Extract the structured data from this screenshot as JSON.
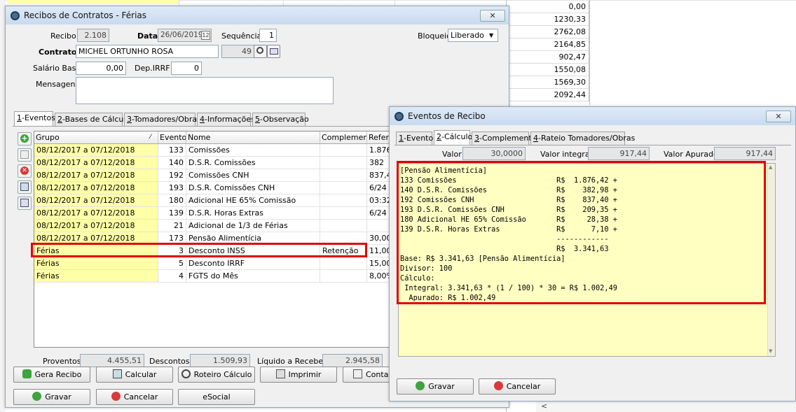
{
  "bg_values": [
    "0,00",
    "1230,33",
    "2762,08",
    "2164,85",
    "902,47",
    "1550,08",
    "1569,30",
    "2092,44"
  ],
  "main": {
    "title": "Recibos de Contratos - Férias",
    "close_label": "✕",
    "recibo_label": "Recibo",
    "recibo_value": "2.108",
    "data_label": "Data",
    "data_value": "26/06/2019",
    "calendar_label": "12",
    "sequencia_label": "Sequência",
    "sequencia_value": "1",
    "bloqueio_label": "Bloqueio",
    "bloqueio_value": "Liberado",
    "contrato_label": "Contrato",
    "contrato_value": "MICHEL ORTUNHO ROSA",
    "contrato_code": "49",
    "salario_label": "Salário Base",
    "salario_value": "0,00",
    "dep_label": "Dep.IRRF",
    "dep_value": "0",
    "mensagens_label": "Mensagens",
    "tabs": [
      {
        "num": "1",
        "label": "-Eventos"
      },
      {
        "num": "2",
        "label": "-Bases de Cálculo"
      },
      {
        "num": "3",
        "label": "-Tomadores/Obras"
      },
      {
        "num": "4",
        "label": "-Informações"
      },
      {
        "num": "5",
        "label": "-Observação"
      }
    ],
    "columns": [
      "Grupo",
      "Evento",
      "Nome",
      "Complemento",
      "Referê"
    ],
    "sort_glyph": "⁄",
    "rows": [
      {
        "grupo": "08/12/2017 a 07/12/2018",
        "evento": "133",
        "nome": "Comissões",
        "complemento": "",
        "referencia": "1.876,"
      },
      {
        "grupo": "08/12/2017 a 07/12/2018",
        "evento": "140",
        "nome": "D.S.R. Comissões",
        "complemento": "",
        "referencia": "382"
      },
      {
        "grupo": "08/12/2017 a 07/12/2018",
        "evento": "192",
        "nome": "Comissões CNH",
        "complemento": "",
        "referencia": "837,40"
      },
      {
        "grupo": "08/12/2017 a 07/12/2018",
        "evento": "193",
        "nome": "D.S.R. Comissões CNH",
        "complemento": "",
        "referencia": "6/24 d"
      },
      {
        "grupo": "08/12/2017 a 07/12/2018",
        "evento": "180",
        "nome": "Adicional HE 65% Comissão",
        "complemento": "",
        "referencia": "03:32"
      },
      {
        "grupo": "08/12/2017 a 07/12/2018",
        "evento": "139",
        "nome": "D.S.R. Horas Extras",
        "complemento": "",
        "referencia": "6/24 d"
      },
      {
        "grupo": "08/12/2017 a 07/12/2018",
        "evento": "21",
        "nome": "Adicional de 1/3 de Férias",
        "complemento": "",
        "referencia": ""
      },
      {
        "grupo": "08/12/2017 a 07/12/2018",
        "evento": "173",
        "nome": "Pensão Alimentícia",
        "complemento": "",
        "referencia": "30,00"
      },
      {
        "grupo": "Férias",
        "evento": "3",
        "nome": "Desconto INSS",
        "complemento": "Retenção",
        "referencia": "11,00"
      },
      {
        "grupo": "Férias",
        "evento": "5",
        "nome": "Desconto IRRF",
        "complemento": "",
        "referencia": "15,00"
      },
      {
        "grupo": "Férias",
        "evento": "4",
        "nome": "FGTS do Mês",
        "complemento": "",
        "referencia": "8,00%"
      }
    ],
    "totals": {
      "proventos_label": "Proventos",
      "proventos_value": "4.455,51",
      "descontos_label": "Descontos",
      "descontos_value": "1.509,93",
      "liquido_label": "Líquido a Receber",
      "liquido_value": "2.945,58"
    },
    "buttons": {
      "gera_recibo": "Gera Recibo",
      "calcular": "Calcular",
      "roteiro": "Roteiro Cálculo",
      "imprimir": "Imprimir",
      "contabilizar": "Conta",
      "gravar": "Gravar",
      "cancelar": "Cancelar",
      "esocial": "eSocial"
    }
  },
  "dialog": {
    "title": "Eventos de Recibo",
    "close_label": "✕",
    "tabs": [
      {
        "num": "1",
        "label": "-Evento"
      },
      {
        "num": "2",
        "label": "-Cálculo"
      },
      {
        "num": "3",
        "label": "-Complemento"
      },
      {
        "num": "4",
        "label": "-Rateio Tomadores/Obras"
      }
    ],
    "valor_label": "Valor",
    "valor_value": "30,0000",
    "valor_integral_label": "Valor integral",
    "valor_integral_value": "917,44",
    "valor_apurado_label": "Valor Apurado",
    "valor_apurado_value": "917,44",
    "calc_text": "[Pensão Alimentícia]\n133 Comissões                       R$  1.876,42 +\n140 D.S.R. Comissões                R$    382,98 +\n192 Comissões CNH                   R$    837,40 +\n193 D.S.R. Comissões CNH            R$    209,35 +\n180 Adicional HE 65% Comissão       R$     28,38 +\n139 D.S.R. Horas Extras             R$      7,10 +\n                                    ------------\n                                    R$  3.341,63\nBase: R$ 3.341,63 [Pensão Alimentícia]\nDivisor: 100\nCálculo:\n Integral: 3.341,63 * (1 / 100) * 30 = R$ 1.002,49\n  Apurado: R$ 1.002,49",
    "gravar": "Gravar",
    "cancelar": "Cancelar"
  }
}
